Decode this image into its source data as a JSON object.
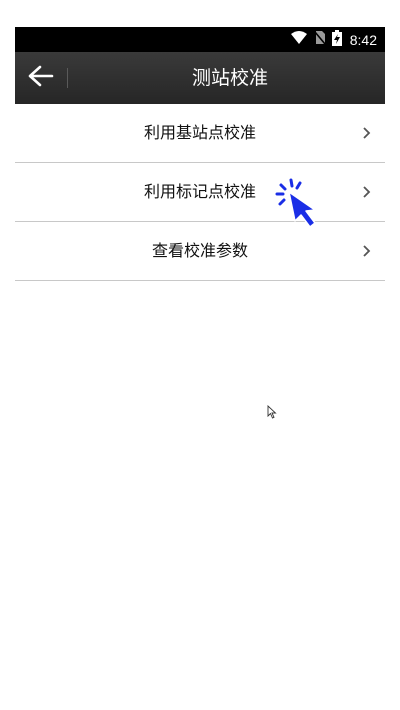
{
  "status_bar": {
    "time": "8:42",
    "icons": [
      "wifi-icon",
      "no-sim-icon",
      "battery-charging-icon"
    ]
  },
  "header": {
    "title": "测站校准",
    "back_icon": "arrow-left-icon"
  },
  "menu": {
    "items": [
      {
        "label": "利用基站点校准",
        "icon": "chevron-right-icon"
      },
      {
        "label": "利用标记点校准",
        "icon": "chevron-right-icon"
      },
      {
        "label": "查看校准参数",
        "icon": "chevron-right-icon"
      }
    ]
  },
  "overlay": {
    "click_indicator_icon": "click-cursor-icon",
    "mouse_pointer_icon": "mouse-pointer-icon",
    "accent_color": "#1a2ee6"
  }
}
